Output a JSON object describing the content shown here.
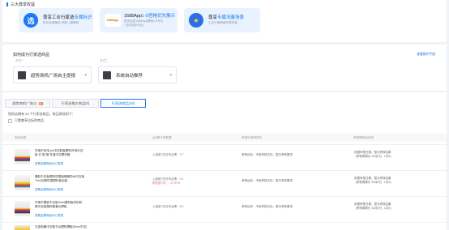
{
  "top": {
    "section_title": "三大尊享权益",
    "rights": [
      {
        "icon": "选",
        "title_prefix": "尊享工业行家选",
        "title_em": "专属标识",
        "line2": "标识全域曝光 流量一键倾斜",
        "line3": ""
      },
      {
        "icon": "1688App",
        "title_prefix": "1688App",
        "title_em": "1-9宫格优先展示",
        "line2": "首页品质1688App搜索1-9专位",
        "line3": "* 活动流量可对比"
      },
      {
        "icon": "奖",
        "title_prefix": "尊享",
        "title_em": "专属流量场景",
        "line2": "工业行家频道专属流量",
        "line3": ""
      }
    ],
    "colors": {
      "accent": "#1677ff",
      "card_bg": "#e9f2ff"
    }
  },
  "select": {
    "title": "如何成为行家选商品",
    "help_link": "查看操作手册",
    "method1_label": "方式一",
    "method2_label": "方式二",
    "method1_value": "趋势商机广场自主提报",
    "method2_value": "系统自动推荐"
  },
  "tabs": [
    {
      "label": "趋势商机广场(1)",
      "badge": "新"
    },
    {
      "label": "行家选推方商品(0)",
      "badge": ""
    },
    {
      "label": "行家选商品(33)",
      "badge": ""
    }
  ],
  "main": {
    "summary_prefix": "您的店铺有 33 个行家选商品，商品表现如下：",
    "checkbox_label": "只看尊享达标的商品",
    "columns": [
      "商品信息",
      "近8周订单数据",
      "考核标准率排名",
      "考核期商品状态"
    ],
    "rows": [
      {
        "name": "环境不定电 plc中控制板塑料外壳中空板 钉 制 固 件盒中空塑料箱",
        "link": "查看近期商品中心表现",
        "metric_line1": "入选前7天日均业绩：7.7",
        "metric_line2": "",
        "criteria": "考核目标：半段考核达标，暂无考核要求",
        "status_line1": "依据考核日期，暂无考核结果",
        "status_line2": "(考核周期为 11月6日 - 1月2)"
      },
      {
        "name": "康胶中空板塑料防撞板硬度防水中空板 7mm加厚防撞塑料板包装",
        "link": "查看近期商品中心表现",
        "metric_line1": "入选前7天日均业绩：2.1",
        "metric_line2": "同比前7天：↑ 17.97%",
        "criteria": "考核目标：半段考核达标，暂无考核要求",
        "status_line1": "依据考核日期，暂无考核结果",
        "status_line2": "(考核周期为 11月6日 - 1月2)"
      },
      {
        "name": "环境不塑胶中空板3mm塑料板材料防 撞中空板塑料整套瓦楞板",
        "link": "查看近期商品中心表现",
        "metric_line1": "入选前7天日均业绩：3.4",
        "metric_line2": "",
        "criteria": "考核目标：半段考核达标，暂无考核要求",
        "status_line1": "依据考核日期，暂无考核结果",
        "status_line2": "(考核周期为 11月6日 - 1月2)"
      },
      {
        "name": "五金电器中空板平台塑料隔板(3mm中空)",
        "link": "",
        "metric_line1": "",
        "metric_line2": "",
        "criteria": "",
        "status_line1": "",
        "status_line2": ""
      }
    ]
  }
}
